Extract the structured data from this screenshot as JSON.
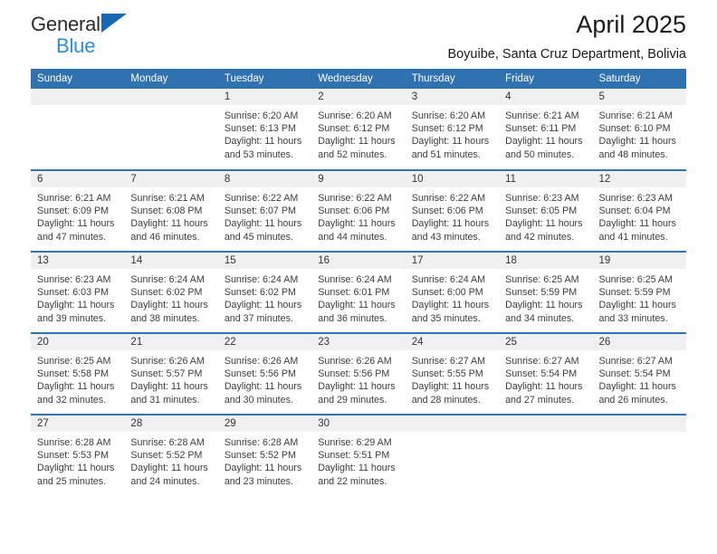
{
  "brand": {
    "name_line1": "General",
    "name_line2": "Blue",
    "triangle_color": "#1668b3",
    "blue_text_color": "#2a8fd8"
  },
  "header": {
    "title": "April 2025",
    "subtitle": "Boyuibe, Santa Cruz Department, Bolivia",
    "header_bg_color": "#3071b0",
    "row_divider_color": "#2e74b5",
    "daynum_bg_color": "#f0f0f0"
  },
  "weekdays": [
    "Sunday",
    "Monday",
    "Tuesday",
    "Wednesday",
    "Thursday",
    "Friday",
    "Saturday"
  ],
  "weeks": [
    [
      {
        "day": "",
        "sunrise": "",
        "sunset": "",
        "daylight": ""
      },
      {
        "day": "",
        "sunrise": "",
        "sunset": "",
        "daylight": ""
      },
      {
        "day": "1",
        "sunrise": "Sunrise: 6:20 AM",
        "sunset": "Sunset: 6:13 PM",
        "daylight": "Daylight: 11 hours and 53 minutes."
      },
      {
        "day": "2",
        "sunrise": "Sunrise: 6:20 AM",
        "sunset": "Sunset: 6:12 PM",
        "daylight": "Daylight: 11 hours and 52 minutes."
      },
      {
        "day": "3",
        "sunrise": "Sunrise: 6:20 AM",
        "sunset": "Sunset: 6:12 PM",
        "daylight": "Daylight: 11 hours and 51 minutes."
      },
      {
        "day": "4",
        "sunrise": "Sunrise: 6:21 AM",
        "sunset": "Sunset: 6:11 PM",
        "daylight": "Daylight: 11 hours and 50 minutes."
      },
      {
        "day": "5",
        "sunrise": "Sunrise: 6:21 AM",
        "sunset": "Sunset: 6:10 PM",
        "daylight": "Daylight: 11 hours and 48 minutes."
      }
    ],
    [
      {
        "day": "6",
        "sunrise": "Sunrise: 6:21 AM",
        "sunset": "Sunset: 6:09 PM",
        "daylight": "Daylight: 11 hours and 47 minutes."
      },
      {
        "day": "7",
        "sunrise": "Sunrise: 6:21 AM",
        "sunset": "Sunset: 6:08 PM",
        "daylight": "Daylight: 11 hours and 46 minutes."
      },
      {
        "day": "8",
        "sunrise": "Sunrise: 6:22 AM",
        "sunset": "Sunset: 6:07 PM",
        "daylight": "Daylight: 11 hours and 45 minutes."
      },
      {
        "day": "9",
        "sunrise": "Sunrise: 6:22 AM",
        "sunset": "Sunset: 6:06 PM",
        "daylight": "Daylight: 11 hours and 44 minutes."
      },
      {
        "day": "10",
        "sunrise": "Sunrise: 6:22 AM",
        "sunset": "Sunset: 6:06 PM",
        "daylight": "Daylight: 11 hours and 43 minutes."
      },
      {
        "day": "11",
        "sunrise": "Sunrise: 6:23 AM",
        "sunset": "Sunset: 6:05 PM",
        "daylight": "Daylight: 11 hours and 42 minutes."
      },
      {
        "day": "12",
        "sunrise": "Sunrise: 6:23 AM",
        "sunset": "Sunset: 6:04 PM",
        "daylight": "Daylight: 11 hours and 41 minutes."
      }
    ],
    [
      {
        "day": "13",
        "sunrise": "Sunrise: 6:23 AM",
        "sunset": "Sunset: 6:03 PM",
        "daylight": "Daylight: 11 hours and 39 minutes."
      },
      {
        "day": "14",
        "sunrise": "Sunrise: 6:24 AM",
        "sunset": "Sunset: 6:02 PM",
        "daylight": "Daylight: 11 hours and 38 minutes."
      },
      {
        "day": "15",
        "sunrise": "Sunrise: 6:24 AM",
        "sunset": "Sunset: 6:02 PM",
        "daylight": "Daylight: 11 hours and 37 minutes."
      },
      {
        "day": "16",
        "sunrise": "Sunrise: 6:24 AM",
        "sunset": "Sunset: 6:01 PM",
        "daylight": "Daylight: 11 hours and 36 minutes."
      },
      {
        "day": "17",
        "sunrise": "Sunrise: 6:24 AM",
        "sunset": "Sunset: 6:00 PM",
        "daylight": "Daylight: 11 hours and 35 minutes."
      },
      {
        "day": "18",
        "sunrise": "Sunrise: 6:25 AM",
        "sunset": "Sunset: 5:59 PM",
        "daylight": "Daylight: 11 hours and 34 minutes."
      },
      {
        "day": "19",
        "sunrise": "Sunrise: 6:25 AM",
        "sunset": "Sunset: 5:59 PM",
        "daylight": "Daylight: 11 hours and 33 minutes."
      }
    ],
    [
      {
        "day": "20",
        "sunrise": "Sunrise: 6:25 AM",
        "sunset": "Sunset: 5:58 PM",
        "daylight": "Daylight: 11 hours and 32 minutes."
      },
      {
        "day": "21",
        "sunrise": "Sunrise: 6:26 AM",
        "sunset": "Sunset: 5:57 PM",
        "daylight": "Daylight: 11 hours and 31 minutes."
      },
      {
        "day": "22",
        "sunrise": "Sunrise: 6:26 AM",
        "sunset": "Sunset: 5:56 PM",
        "daylight": "Daylight: 11 hours and 30 minutes."
      },
      {
        "day": "23",
        "sunrise": "Sunrise: 6:26 AM",
        "sunset": "Sunset: 5:56 PM",
        "daylight": "Daylight: 11 hours and 29 minutes."
      },
      {
        "day": "24",
        "sunrise": "Sunrise: 6:27 AM",
        "sunset": "Sunset: 5:55 PM",
        "daylight": "Daylight: 11 hours and 28 minutes."
      },
      {
        "day": "25",
        "sunrise": "Sunrise: 6:27 AM",
        "sunset": "Sunset: 5:54 PM",
        "daylight": "Daylight: 11 hours and 27 minutes."
      },
      {
        "day": "26",
        "sunrise": "Sunrise: 6:27 AM",
        "sunset": "Sunset: 5:54 PM",
        "daylight": "Daylight: 11 hours and 26 minutes."
      }
    ],
    [
      {
        "day": "27",
        "sunrise": "Sunrise: 6:28 AM",
        "sunset": "Sunset: 5:53 PM",
        "daylight": "Daylight: 11 hours and 25 minutes."
      },
      {
        "day": "28",
        "sunrise": "Sunrise: 6:28 AM",
        "sunset": "Sunset: 5:52 PM",
        "daylight": "Daylight: 11 hours and 24 minutes."
      },
      {
        "day": "29",
        "sunrise": "Sunrise: 6:28 AM",
        "sunset": "Sunset: 5:52 PM",
        "daylight": "Daylight: 11 hours and 23 minutes."
      },
      {
        "day": "30",
        "sunrise": "Sunrise: 6:29 AM",
        "sunset": "Sunset: 5:51 PM",
        "daylight": "Daylight: 11 hours and 22 minutes."
      },
      {
        "day": "",
        "sunrise": "",
        "sunset": "",
        "daylight": ""
      },
      {
        "day": "",
        "sunrise": "",
        "sunset": "",
        "daylight": ""
      },
      {
        "day": "",
        "sunrise": "",
        "sunset": "",
        "daylight": ""
      }
    ]
  ]
}
